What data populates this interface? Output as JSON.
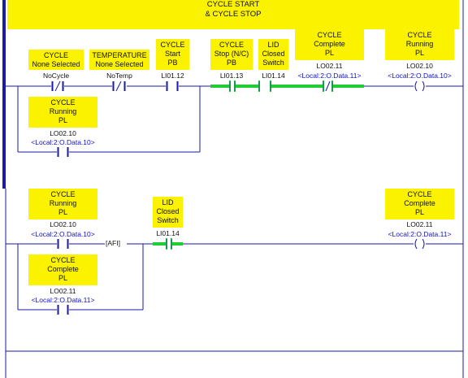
{
  "rung_comment": {
    "line1": "CYCLE START",
    "line2": "& CYCLE STOP"
  },
  "rung0": {
    "cycle_none_selected": {
      "desc1": "CYCLE",
      "desc2": "None Selected",
      "tag": "NoCycle"
    },
    "temperature": {
      "desc1": "TEMPERATURE",
      "desc2": "None Selected",
      "tag": "NoTemp"
    },
    "cycle_start": {
      "desc1": "CYCLE",
      "desc2": "Start",
      "desc3": "PB",
      "tag": "LI01.12"
    },
    "cycle_stop": {
      "desc1": "CYCLE",
      "desc2": "Stop (N/C)",
      "desc3": "PB",
      "tag": "LI01.13"
    },
    "lid_closed": {
      "desc1": "LID",
      "desc2": "Closed",
      "desc3": "Switch",
      "tag": "LI01.14"
    },
    "cycle_complete": {
      "desc1": "CYCLE",
      "desc2": "Complete",
      "desc3": "PL",
      "tag": "LO02.11",
      "alias": "<Local:2:O.Data.11>"
    },
    "coil_running": {
      "desc1": "CYCLE",
      "desc2": "Running",
      "desc3": "PL",
      "tag": "LO02.10",
      "alias": "<Local:2:O.Data.10>"
    },
    "branch_running": {
      "desc1": "CYCLE",
      "desc2": "Running",
      "desc3": "PL",
      "tag": "LO02.10",
      "alias": "<Local:2:O.Data.10>"
    }
  },
  "rung1": {
    "cycle_running": {
      "desc1": "CYCLE",
      "desc2": "Running",
      "desc3": "PL",
      "tag": "LO02.10",
      "alias": "<Local:2:O.Data.10>"
    },
    "afi_label": "AFI",
    "lid_closed": {
      "desc1": "LID",
      "desc2": "Closed",
      "desc3": "Switch",
      "tag": "LI01.14"
    },
    "coil_complete": {
      "desc1": "CYCLE",
      "desc2": "Complete",
      "desc3": "PL",
      "tag": "LO02.11",
      "alias": "<Local:2:O.Data.11>"
    },
    "branch_complete": {
      "desc1": "CYCLE",
      "desc2": "Complete",
      "desc3": "PL",
      "tag": "LO02.11",
      "alias": "<Local:2:O.Data.11>"
    }
  },
  "colors": {
    "wire": "#1a1aa8",
    "energized": "#22cc33",
    "label_bg": "#fbf200",
    "alias": "#1010c8"
  }
}
